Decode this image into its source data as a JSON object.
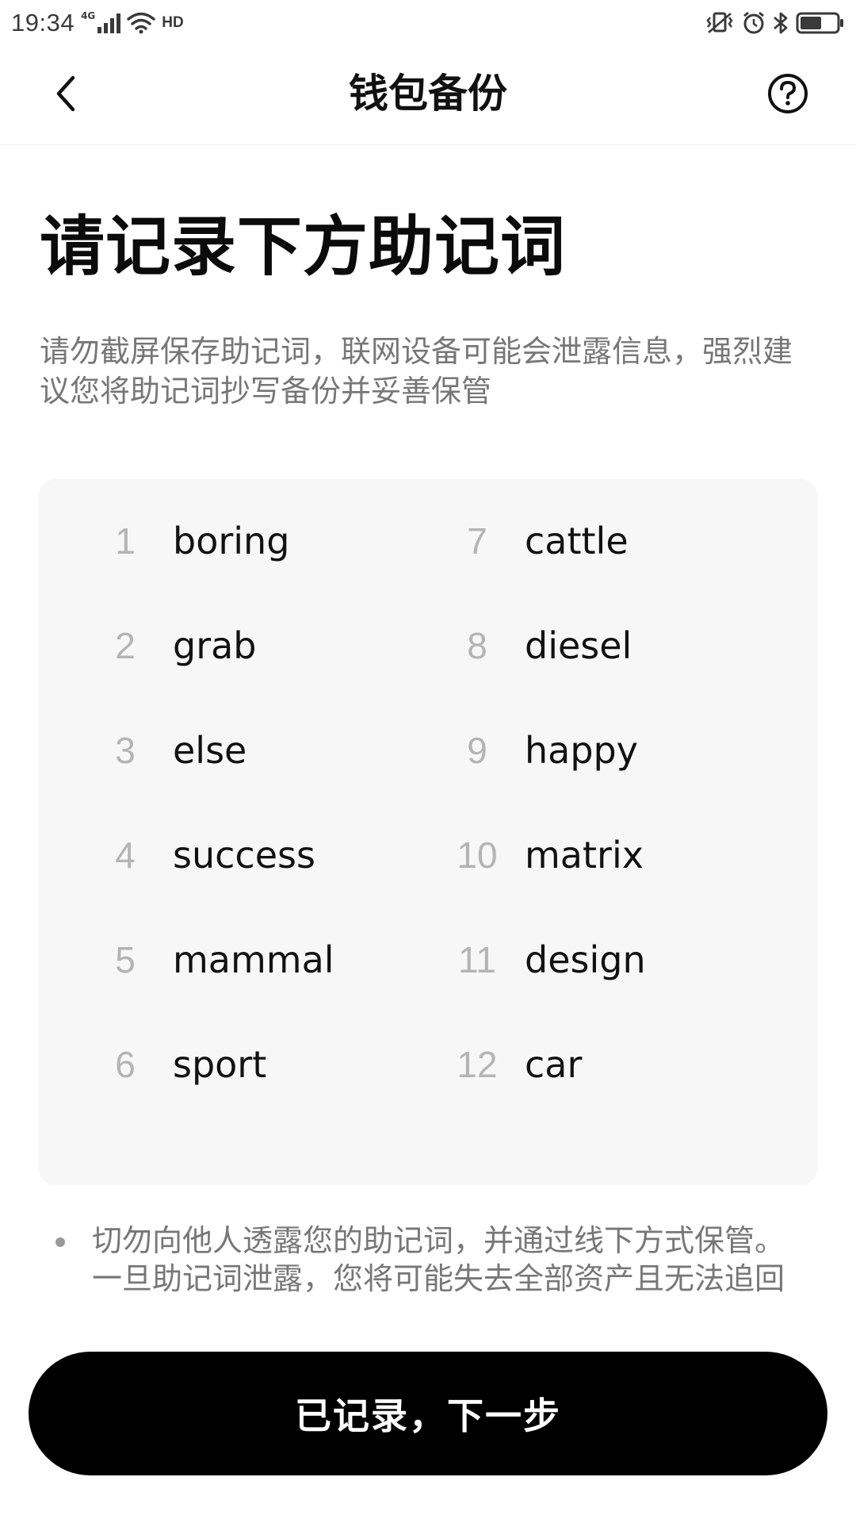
{
  "status_bar": {
    "time": "19:34",
    "network": "4G",
    "hd": "HD",
    "icons": [
      "signal-icon",
      "wifi-icon",
      "hd-icon",
      "vibrate-icon",
      "alarm-icon",
      "bluetooth-icon",
      "battery-icon"
    ],
    "battery_level": 0.55
  },
  "header": {
    "title": "钱包备份",
    "back_icon": "chevron-left-icon",
    "help_icon": "question-circle-icon"
  },
  "main": {
    "title": "请记录下方助记词",
    "warning": "请勿截屏保存助记词，联网设备可能会泄露信息，强烈建议您将助记词抄写备份并妥善保管"
  },
  "mnemonic": {
    "words": [
      {
        "index": "1",
        "word": "boring"
      },
      {
        "index": "2",
        "word": "grab"
      },
      {
        "index": "3",
        "word": "else"
      },
      {
        "index": "4",
        "word": "success"
      },
      {
        "index": "5",
        "word": "mammal"
      },
      {
        "index": "6",
        "word": "sport"
      },
      {
        "index": "7",
        "word": "cattle"
      },
      {
        "index": "8",
        "word": "diesel"
      },
      {
        "index": "9",
        "word": "happy"
      },
      {
        "index": "10",
        "word": "matrix"
      },
      {
        "index": "11",
        "word": "design"
      },
      {
        "index": "12",
        "word": "car"
      }
    ]
  },
  "note": {
    "text": "切勿向他人透露您的助记词，并通过线下方式保管。一旦助记词泄露，您将可能失去全部资产且无法追回"
  },
  "footer": {
    "next_label": "已记录，下一步"
  },
  "colors": {
    "card_background": "#f7f7f7",
    "primary_button": "#000000",
    "muted_text": "#777777",
    "index_text": "#b4b4b4"
  }
}
